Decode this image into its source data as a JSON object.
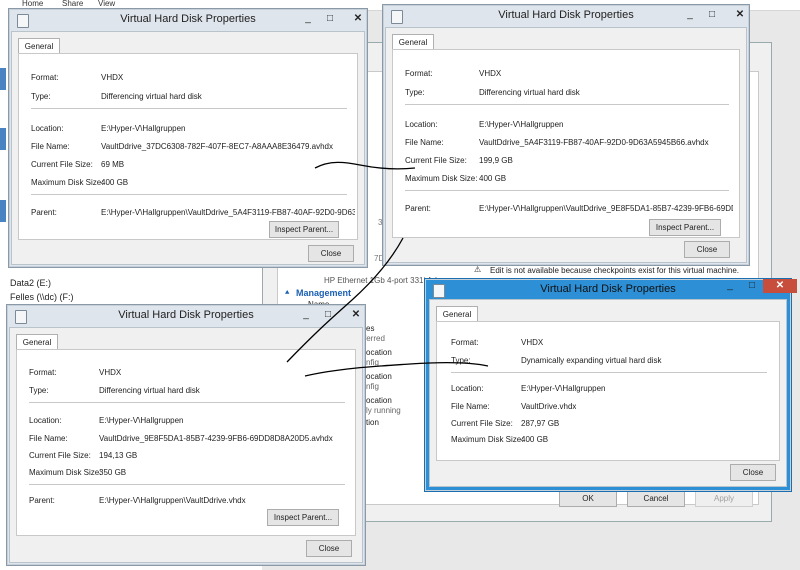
{
  "ribbon": {
    "tabs": [
      "Home",
      "Share",
      "View"
    ]
  },
  "explorer": {
    "drives": [
      "Data2 (E:)",
      "Felles (\\\\dc) (F:)"
    ]
  },
  "vm_settings": {
    "nic_label": "HP Ethernet 1Gb 4-port 331i Adap",
    "management_label": "Management",
    "name_item": "Name",
    "notice": "Edit is not available because checkpoints exist for this virtual machine.",
    "partial_labels": [
      "es",
      "ferred",
      "ocation",
      "nfig",
      "ocation",
      "nfig",
      "ocation",
      "ly running",
      "tion"
    ],
    "partial_ids": [
      "3C-0",
      "7DC"
    ],
    "ok_label": "OK",
    "cancel_label": "Cancel",
    "apply_label": "Apply"
  },
  "dialogs": {
    "d1": {
      "title": "Virtual Hard Disk Properties",
      "tab": "General",
      "format_label": "Format:",
      "format": "VHDX",
      "type_label": "Type:",
      "type": "Differencing virtual hard disk",
      "location_label": "Location:",
      "location": "E:\\Hyper-V\\Hallgruppen",
      "filename_label": "File Name:",
      "filename": "VaultDdrive_37DC6308-782F-407F-8EC7-A8AAA8E36479.avhdx",
      "cursize_label": "Current File Size:",
      "cursize": "69 MB",
      "maxsize_label": "Maximum Disk Size:",
      "maxsize": "400 GB",
      "parent_label": "Parent:",
      "parent": "E:\\Hyper-V\\Hallgruppen\\VaultDdrive_5A4F3119-FB87-40AF-92D0-9D63",
      "inspect_label": "Inspect Parent...",
      "close_label": "Close"
    },
    "d2": {
      "title": "Virtual Hard Disk Properties",
      "tab": "General",
      "format_label": "Format:",
      "format": "VHDX",
      "type_label": "Type:",
      "type": "Differencing virtual hard disk",
      "location_label": "Location:",
      "location": "E:\\Hyper-V\\Hallgruppen",
      "filename_label": "File Name:",
      "filename": "VaultDdrive_5A4F3119-FB87-40AF-92D0-9D63A5945B66.avhdx",
      "cursize_label": "Current File Size:",
      "cursize": "199,9 GB",
      "maxsize_label": "Maximum Disk Size:",
      "maxsize": "400 GB",
      "parent_label": "Parent:",
      "parent": "E:\\Hyper-V\\Hallgruppen\\VaultDdrive_9E8F5DA1-85B7-4239-9FB6-69DD",
      "inspect_label": "Inspect Parent...",
      "close_label": "Close"
    },
    "d3": {
      "title": "Virtual Hard Disk Properties",
      "tab": "General",
      "format_label": "Format:",
      "format": "VHDX",
      "type_label": "Type:",
      "type": "Differencing virtual hard disk",
      "location_label": "Location:",
      "location": "E:\\Hyper-V\\Hallgruppen",
      "filename_label": "File Name:",
      "filename": "VaultDdrive_9E8F5DA1-85B7-4239-9FB6-69DD8D8A20D5.avhdx",
      "cursize_label": "Current File Size:",
      "cursize": "194,13 GB",
      "maxsize_label": "Maximum Disk Size:",
      "maxsize": "350 GB",
      "parent_label": "Parent:",
      "parent": "E:\\Hyper-V\\Hallgruppen\\VaultDdrive.vhdx",
      "inspect_label": "Inspect Parent...",
      "close_label": "Close"
    },
    "d4": {
      "title": "Virtual Hard Disk Properties",
      "tab": "General",
      "format_label": "Format:",
      "format": "VHDX",
      "type_label": "Type:",
      "type": "Dynamically expanding virtual hard disk",
      "location_label": "Location:",
      "location": "E:\\Hyper-V\\Hallgruppen",
      "filename_label": "File Name:",
      "filename": "VaultDrive.vhdx",
      "cursize_label": "Current File Size:",
      "cursize": "287,97 GB",
      "maxsize_label": "Maximum Disk Size:",
      "maxsize": "400 GB",
      "close_label": "Close"
    }
  },
  "window_controls": {
    "minimize": "_",
    "maximize": "□",
    "close": "✕"
  },
  "colors": {
    "active_frame": "#2d8fd6",
    "close_red": "#c74d3c",
    "inactive_frame": "#dfe5ec",
    "ink": "#000000"
  }
}
